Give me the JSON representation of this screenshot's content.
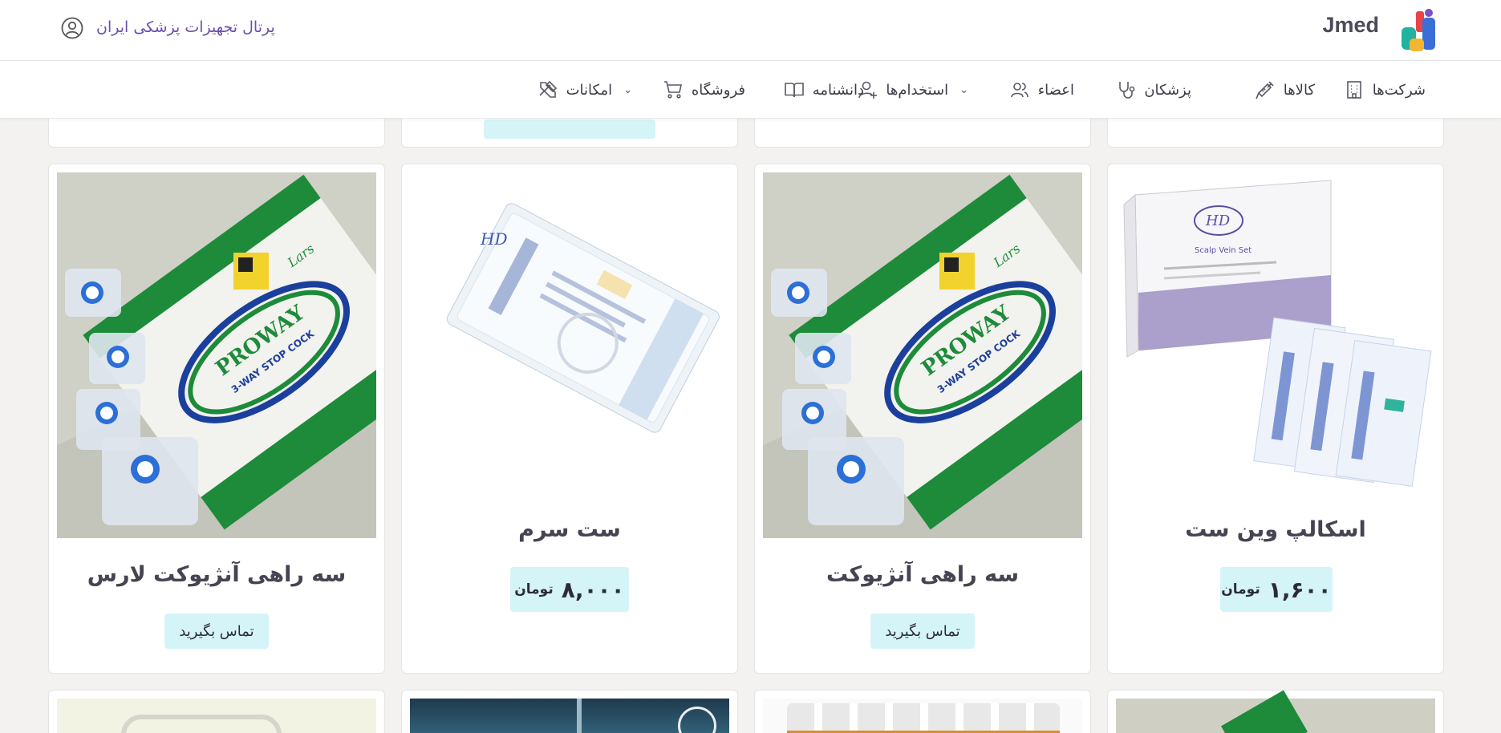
{
  "header": {
    "brand": "Jmed",
    "portal_title": "پرتال تجهیزات پزشکی ایران"
  },
  "nav": {
    "companies": "شرکت‌ها",
    "products": "کالاها",
    "doctors": "پزشکان",
    "members": "اعضاء",
    "jobs": "استخدام‌ها",
    "encyclopedia": "دانشنامه",
    "shop": "فروشگاه",
    "features": "امکانات"
  },
  "products": [
    {
      "title": "اسکالپ وین ست",
      "price": "۱,۶۰۰",
      "currency": "تومان"
    },
    {
      "title": "سه راهی آنژیوکت",
      "action": "تماس بگیرید"
    },
    {
      "title": "ست سرم",
      "price": "۸,۰۰۰",
      "currency": "تومان"
    },
    {
      "title": "سه راهی آنژیوکت لارس",
      "action": "تماس بگیرید"
    }
  ],
  "image_text": {
    "proway": "PROWAY",
    "stopcock": "3-WAY STOP COCK",
    "lars": "Lars",
    "hd": "HD",
    "scalp": "Scalp Vein Set"
  },
  "colors": {
    "accent_bg": "#d5f4f7",
    "portal_text": "#6b4fb0",
    "page_bg": "#f3f2f0"
  }
}
